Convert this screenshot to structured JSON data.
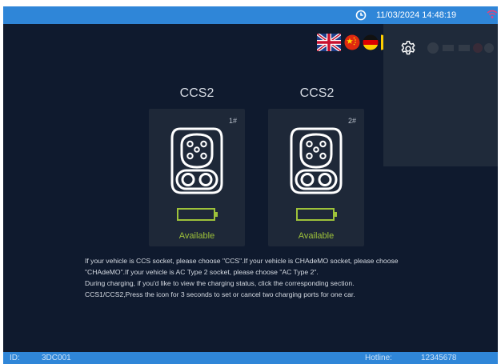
{
  "status_bar": {
    "datetime": "11/03/2024 14:48:19"
  },
  "languages": [
    {
      "name": "english",
      "icon": "uk-flag-icon"
    },
    {
      "name": "chinese",
      "icon": "china-flag-icon"
    },
    {
      "name": "german",
      "icon": "germany-flag-icon"
    }
  ],
  "connectors": [
    {
      "title": "CCS2",
      "number": "1#",
      "status": "Available"
    },
    {
      "title": "CCS2",
      "number": "2#",
      "status": "Available"
    }
  ],
  "instructions": [
    "If your vehicle is CCS socket, please choose \"CCS\".If your vehicle is CHAdeMO socket, please choose",
    "\"CHAdeMO\".If your vehicle is AC Type 2 socket, please choose \"AC Type 2\".",
    "During charging, if you'd like to view the charging status, click the corresponding section.",
    "CCS1/CCS2,Press the icon for 3 seconds to set or cancel two charging ports for one car."
  ],
  "footer": {
    "id_label": "ID:",
    "id_value": "3DC001",
    "hotline_label": "Hotline:",
    "hotline_value": "12345678"
  },
  "colors": {
    "background": "#0f1a2e",
    "bar": "#2f86d8",
    "available": "#9ec23a"
  }
}
